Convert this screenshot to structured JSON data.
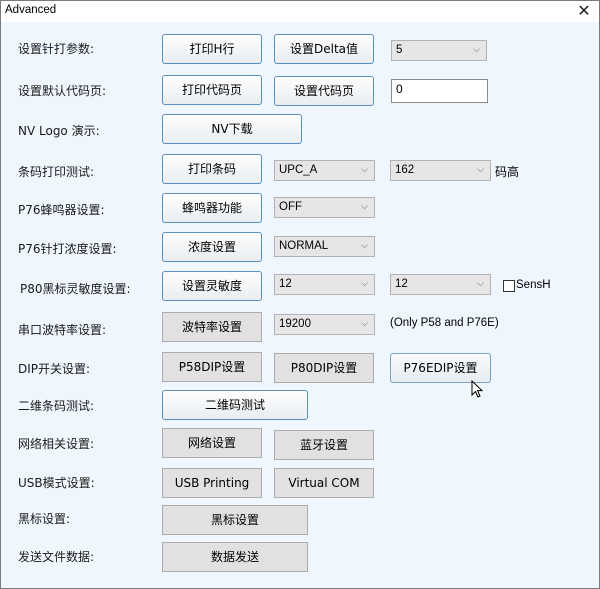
{
  "window": {
    "title": "Advanced",
    "close_icon": "close-icon"
  },
  "rows": {
    "pin_params": {
      "label": "设置针打参数:",
      "btn1": "打印H行",
      "btn2": "设置Delta值",
      "select": "5"
    },
    "codepage": {
      "label": "设置默认代码页:",
      "btn1": "打印代码页",
      "btn2": "设置代码页",
      "input": "0"
    },
    "nv_logo": {
      "label": "NV Logo 演示:",
      "btn1": "NV下载"
    },
    "barcode": {
      "label": "条码打印测试:",
      "btn1": "打印条码",
      "select1": "UPC_A",
      "select2": "162",
      "suffix": "码高"
    },
    "buzzer": {
      "label": "P76蜂鸣器设置:",
      "btn1": "蜂鸣器功能",
      "select": "OFF"
    },
    "density": {
      "label": "P76针打浓度设置:",
      "btn1": "浓度设置",
      "select": "NORMAL"
    },
    "sensitivity": {
      "label": "P80黑标灵敏度设置:",
      "btn1": "设置灵敏度",
      "select1": "12",
      "select2": "12",
      "checkbox_label": "SensH",
      "checkbox_checked": false
    },
    "baud": {
      "label": "串口波特率设置:",
      "btn1": "波特率设置",
      "select": "19200",
      "note": "(Only P58 and P76E)"
    },
    "dip": {
      "label": "DIP开关设置:",
      "btn1": "P58DIP设置",
      "btn2": "P80DIP设置",
      "btn3": "P76EDIP设置"
    },
    "qrcode": {
      "label": "二维条码测试:",
      "btn1": "二维码测试"
    },
    "network": {
      "label": "网络相关设置:",
      "btn1": "网络设置",
      "btn2": "蓝牙设置"
    },
    "usb": {
      "label": "USB模式设置:",
      "btn1": "USB Printing",
      "btn2": "Virtual COM"
    },
    "blackmark": {
      "label": "黑标设置:",
      "btn1": "黑标设置"
    },
    "sendfile": {
      "label": "发送文件数据:",
      "btn1": "数据发送"
    }
  }
}
